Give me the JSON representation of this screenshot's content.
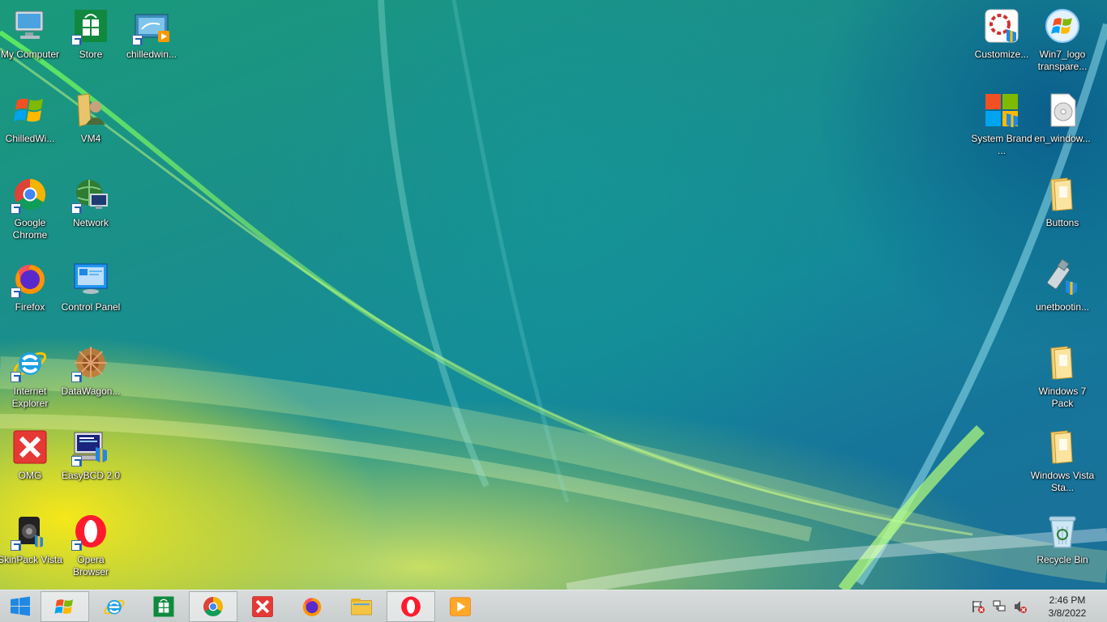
{
  "desktop": {
    "left_column_1": [
      {
        "label": "My Computer",
        "icon": "computer-icon"
      },
      {
        "label": "ChilledWi...",
        "icon": "windows-flag-icon"
      },
      {
        "label": "Google Chrome",
        "icon": "chrome-icon"
      },
      {
        "label": "Firefox",
        "icon": "firefox-icon"
      },
      {
        "label": "Internet Explorer",
        "icon": "internet-explorer-icon"
      },
      {
        "label": "OMG",
        "icon": "red-x-icon"
      },
      {
        "label": "SkinPack Vista",
        "icon": "skinpack-icon"
      }
    ],
    "left_column_2": [
      {
        "label": "Store",
        "icon": "store-icon"
      },
      {
        "label": "VM4",
        "icon": "user-folder-icon"
      },
      {
        "label": "Network",
        "icon": "network-icon"
      },
      {
        "label": "Control Panel",
        "icon": "control-panel-icon"
      },
      {
        "label": "DataWagon...",
        "icon": "datawagon-icon"
      },
      {
        "label": "EasyBCD 2.0",
        "icon": "easybcd-icon"
      },
      {
        "label": "Opera Browser",
        "icon": "opera-icon"
      }
    ],
    "left_column_3": [
      {
        "label": "chilledwin...",
        "icon": "video-file-icon"
      }
    ],
    "right_column_1": [
      {
        "label": "Customize...",
        "icon": "customize-icon"
      },
      {
        "label": "System Brand ...",
        "icon": "system-brand-icon"
      }
    ],
    "right_column_2": [
      {
        "label": "Win7_logo transpare...",
        "icon": "win7-logo-icon"
      },
      {
        "label": "en_window...",
        "icon": "disc-image-icon"
      },
      {
        "label": "Buttons",
        "icon": "folder-icon"
      },
      {
        "label": "unetbootin...",
        "icon": "usb-icon"
      },
      {
        "label": "Windows 7 Pack",
        "icon": "folder-icon"
      },
      {
        "label": "Windows Vista Sta...",
        "icon": "folder-icon"
      },
      {
        "label": "Recycle Bin",
        "icon": "recycle-bin-icon"
      }
    ]
  },
  "taskbar": {
    "buttons": [
      {
        "name": "windows-7-flag",
        "icon": "windows-flag-icon",
        "active": true
      },
      {
        "name": "internet-explorer",
        "icon": "internet-explorer-icon",
        "active": false
      },
      {
        "name": "store",
        "icon": "store-icon",
        "active": false
      },
      {
        "name": "chrome",
        "icon": "chrome-icon",
        "active": true
      },
      {
        "name": "omg",
        "icon": "red-x-icon",
        "active": false
      },
      {
        "name": "firefox",
        "icon": "firefox-icon",
        "active": false
      },
      {
        "name": "file-explorer",
        "icon": "file-explorer-icon",
        "active": false
      },
      {
        "name": "opera",
        "icon": "opera-icon",
        "active": true
      },
      {
        "name": "media-player",
        "icon": "media-player-icon",
        "active": false
      }
    ],
    "tray_icons": [
      "action-center-flag-icon",
      "network-tray-icon",
      "volume-muted-icon"
    ],
    "clock": {
      "time": "2:46 PM",
      "date": "3/8/2022"
    }
  },
  "colors": {
    "taskbar_bg": "#cfd3d3",
    "label_text": "#ffffff"
  }
}
